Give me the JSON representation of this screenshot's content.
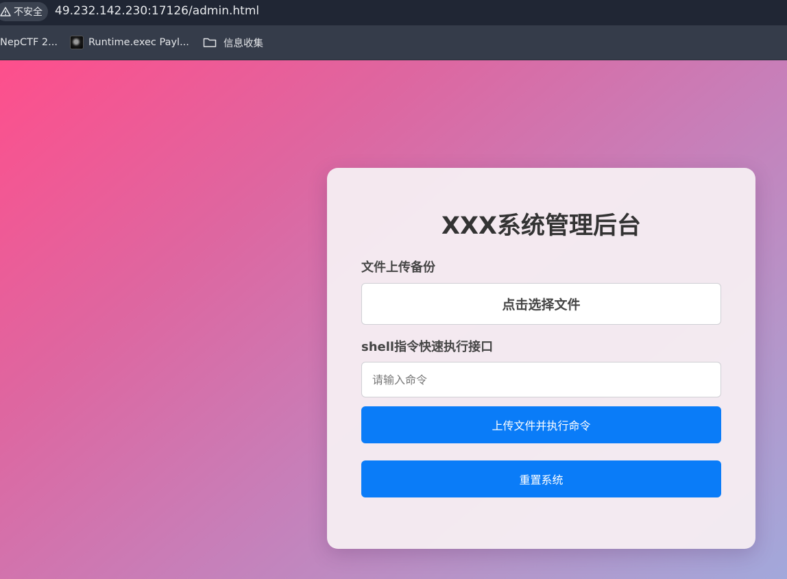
{
  "browser": {
    "security_label": "不安全",
    "url": "49.232.142.230:17126/admin.html",
    "bookmarks": [
      {
        "label": "NepCTF 2...",
        "icon": "none"
      },
      {
        "label": "Runtime.exec Payl...",
        "icon": "site-favicon"
      },
      {
        "label": "信息收集",
        "icon": "folder-icon"
      }
    ]
  },
  "card": {
    "title": "XXX系统管理后台",
    "upload_label": "文件上传备份",
    "file_button_label": "点击选择文件",
    "shell_label": "shell指令快速执行接口",
    "command_placeholder": "请输入命令",
    "command_value": "",
    "exec_button_label": "上传文件并执行命令",
    "reset_button_label": "重置系统"
  },
  "colors": {
    "accent": "#0a7cf8",
    "gradient_start": "#fe4f8c",
    "gradient_end": "#a2a8db",
    "chrome_bg": "#202634"
  }
}
